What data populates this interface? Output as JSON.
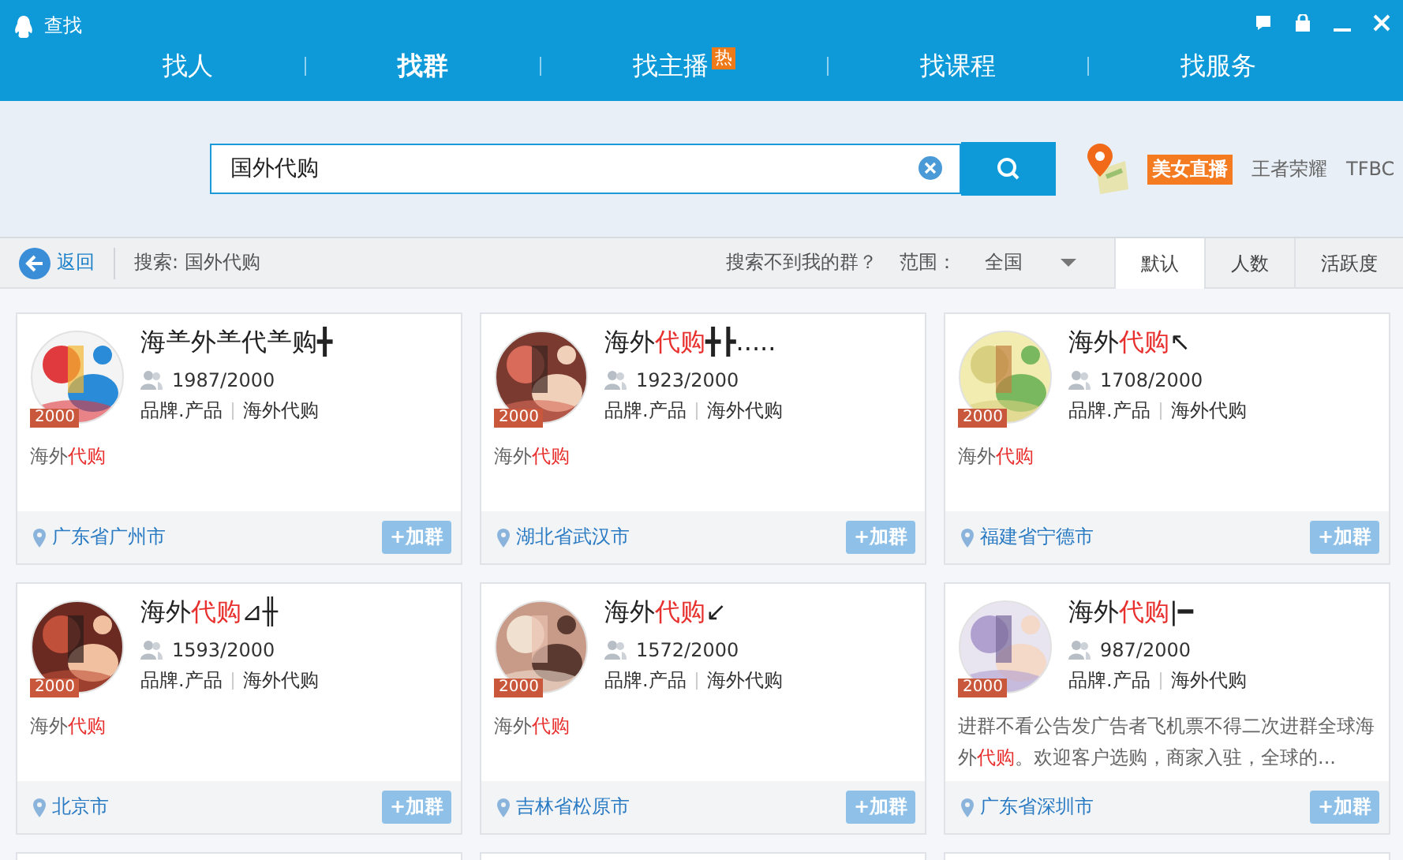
{
  "window": {
    "title": "查找"
  },
  "tabs": [
    {
      "label": "找人",
      "selected": false
    },
    {
      "label": "找群",
      "selected": true
    },
    {
      "label": "找主播",
      "selected": false,
      "badge": "热"
    },
    {
      "label": "找课程",
      "selected": false
    },
    {
      "label": "找服务",
      "selected": false
    }
  ],
  "search": {
    "value": "国外代购"
  },
  "hot_tags": [
    {
      "label": "美女直播",
      "kind": "tag"
    },
    {
      "label": "王者荣耀",
      "kind": "plain"
    },
    {
      "label": "TFBC",
      "kind": "plain"
    }
  ],
  "toolbar": {
    "back": "返回",
    "query": "搜索: 国外代购",
    "help": "搜索不到我的群？",
    "range_label": "范围：",
    "range_value": "全国",
    "sorts": [
      {
        "label": "默认",
        "selected": true
      },
      {
        "label": "人数",
        "selected": false
      },
      {
        "label": "活跃度",
        "selected": false
      }
    ]
  },
  "groups": [
    {
      "name": [
        {
          "text": "海⺷外⺷代⺷购╋",
          "highlight": false
        }
      ],
      "badge": "2000",
      "members": "1987/2000",
      "tags": [
        "品牌.产品",
        "海外代购"
      ],
      "description": [
        {
          "text": "海外",
          "highlight": false
        },
        {
          "text": "代购",
          "highlight": true
        }
      ],
      "location": "广东省广州市",
      "join": "+加群"
    },
    {
      "name": [
        {
          "text": "海外",
          "highlight": false
        },
        {
          "text": "代购",
          "highlight": true
        },
        {
          "text": "╋┣.....",
          "highlight": false
        }
      ],
      "badge": "2000",
      "members": "1923/2000",
      "tags": [
        "品牌.产品",
        "海外代购"
      ],
      "description": [
        {
          "text": "海外",
          "highlight": false
        },
        {
          "text": "代购",
          "highlight": true
        }
      ],
      "location": "湖北省武汉市",
      "join": "+加群"
    },
    {
      "name": [
        {
          "text": "海外",
          "highlight": false
        },
        {
          "text": "代购",
          "highlight": true
        },
        {
          "text": "↖",
          "highlight": false
        }
      ],
      "badge": "2000",
      "members": "1708/2000",
      "tags": [
        "品牌.产品",
        "海外代购"
      ],
      "description": [
        {
          "text": "海外",
          "highlight": false
        },
        {
          "text": "代购",
          "highlight": true
        }
      ],
      "location": "福建省宁德市",
      "join": "+加群"
    },
    {
      "name": [
        {
          "text": "海外",
          "highlight": false
        },
        {
          "text": "代购",
          "highlight": true
        },
        {
          "text": "⊿╫",
          "highlight": false
        }
      ],
      "badge": "2000",
      "members": "1593/2000",
      "tags": [
        "品牌.产品",
        "海外代购"
      ],
      "description": [
        {
          "text": "海外",
          "highlight": false
        },
        {
          "text": "代购",
          "highlight": true
        }
      ],
      "location": "北京市",
      "join": "+加群"
    },
    {
      "name": [
        {
          "text": "海外",
          "highlight": false
        },
        {
          "text": "代购",
          "highlight": true
        },
        {
          "text": "↙",
          "highlight": false
        }
      ],
      "badge": "2000",
      "members": "1572/2000",
      "tags": [
        "品牌.产品",
        "海外代购"
      ],
      "description": [
        {
          "text": "海外",
          "highlight": false
        },
        {
          "text": "代购",
          "highlight": true
        }
      ],
      "location": "吉林省松原市",
      "join": "+加群"
    },
    {
      "name": [
        {
          "text": "海外",
          "highlight": false
        },
        {
          "text": "代购",
          "highlight": true
        },
        {
          "text": "|━",
          "highlight": false
        }
      ],
      "badge": "2000",
      "members": "987/2000",
      "tags": [
        "品牌.产品",
        "海外代购"
      ],
      "description": [
        {
          "text": "进群不看公告发广告者飞机票不得二次进群全球海外",
          "highlight": false
        },
        {
          "text": "代购",
          "highlight": true
        },
        {
          "text": "。欢迎客户选购，商家入驻，全球的...",
          "highlight": false
        }
      ],
      "location": "广东省深圳市",
      "join": "+加群"
    }
  ]
}
